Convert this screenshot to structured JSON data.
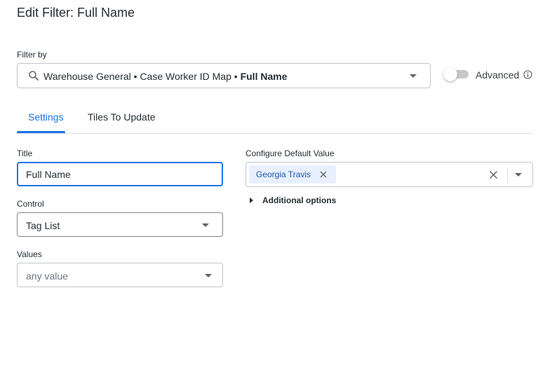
{
  "dialog": {
    "title": "Edit Filter: Full Name"
  },
  "filter_by": {
    "label": "Filter by",
    "value_prefix": "Warehouse General • Case Worker ID Map • ",
    "value_field": "Full Name",
    "icon": "search-icon"
  },
  "advanced": {
    "label": "Advanced",
    "enabled": false,
    "info_icon": "info-icon"
  },
  "tabs": [
    {
      "label": "Settings",
      "active": true
    },
    {
      "label": "Tiles To Update",
      "active": false
    }
  ],
  "settings": {
    "title_label": "Title",
    "title_value": "Full Name",
    "control_label": "Control",
    "control_value": "Tag List",
    "values_label": "Values",
    "values_placeholder": "any value",
    "default_label": "Configure Default Value",
    "default_tags": [
      "Georgia Travis"
    ],
    "additional_options_label": "Additional options"
  },
  "colors": {
    "accent": "#1a73e8",
    "chip_bg": "#e8f0fe",
    "chip_text": "#1a56b8",
    "text": "#262d33",
    "border": "#c1c6cc"
  }
}
